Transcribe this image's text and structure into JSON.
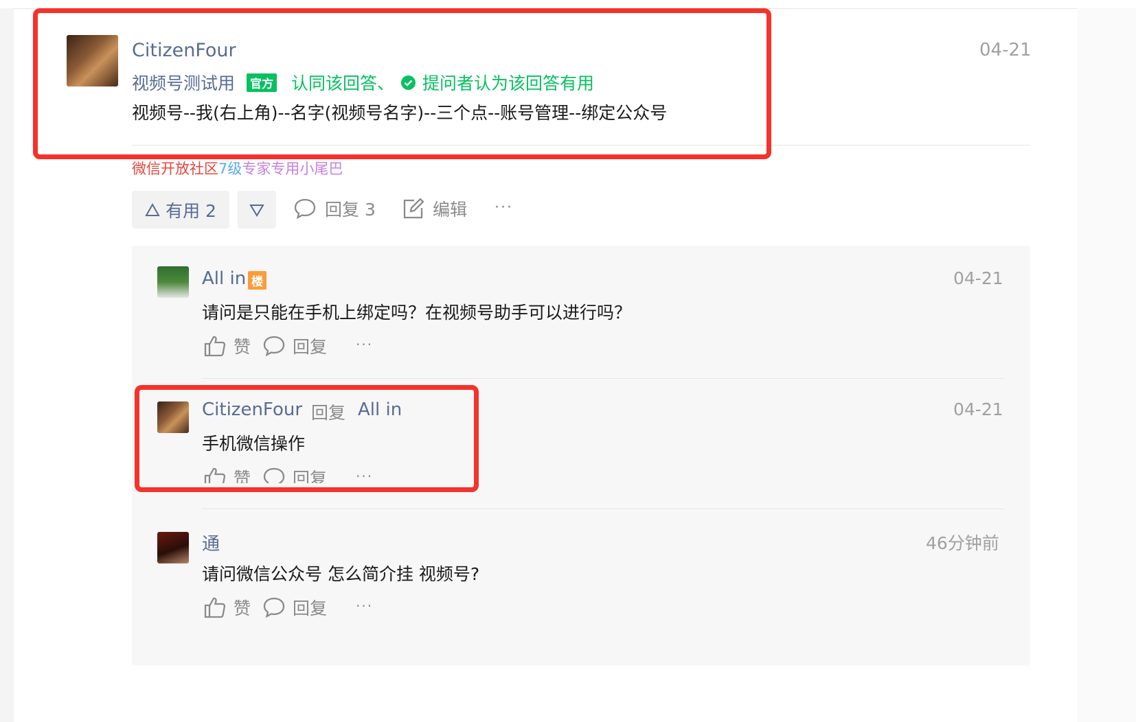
{
  "answer": {
    "author": "CitizenFour",
    "date": "04-21",
    "endorser": "视频号测试用",
    "endorser_badge": "官方",
    "endorse_text": "认同该回答、",
    "asker_text": "提问者认为该回答有用",
    "content": "视频号--我(右上角)--名字(视频号名字)--三个点--账号管理--绑定公众号",
    "signature_parts": [
      "微信开放社区",
      "7级",
      "专家专用小尾巴"
    ],
    "useful_label": "有用 2",
    "reply_label": "回复 3",
    "edit_label": "编辑",
    "more_label": "···"
  },
  "replies": [
    {
      "author": "All in",
      "badge": "楼",
      "date": "04-21",
      "content": "请问是只能在手机上绑定吗？在视频号助手可以进行吗？",
      "like_label": "赞",
      "reply_label": "回复",
      "more_label": "···"
    },
    {
      "author": "CitizenFour",
      "reply_word": "回复",
      "reply_to": "All in",
      "date": "04-21",
      "content": "手机微信操作",
      "like_label": "赞",
      "reply_label": "回复",
      "more_label": "···"
    },
    {
      "author": "通",
      "date": "46分钟前",
      "content": "请问微信公众号 怎么简介挂 视频号?",
      "like_label": "赞",
      "reply_label": "回复",
      "more_label": "···"
    }
  ],
  "colors": {
    "link": "#576b95",
    "green": "#07c160",
    "highlight": "#f5322b",
    "muted": "#a0a0a0"
  }
}
